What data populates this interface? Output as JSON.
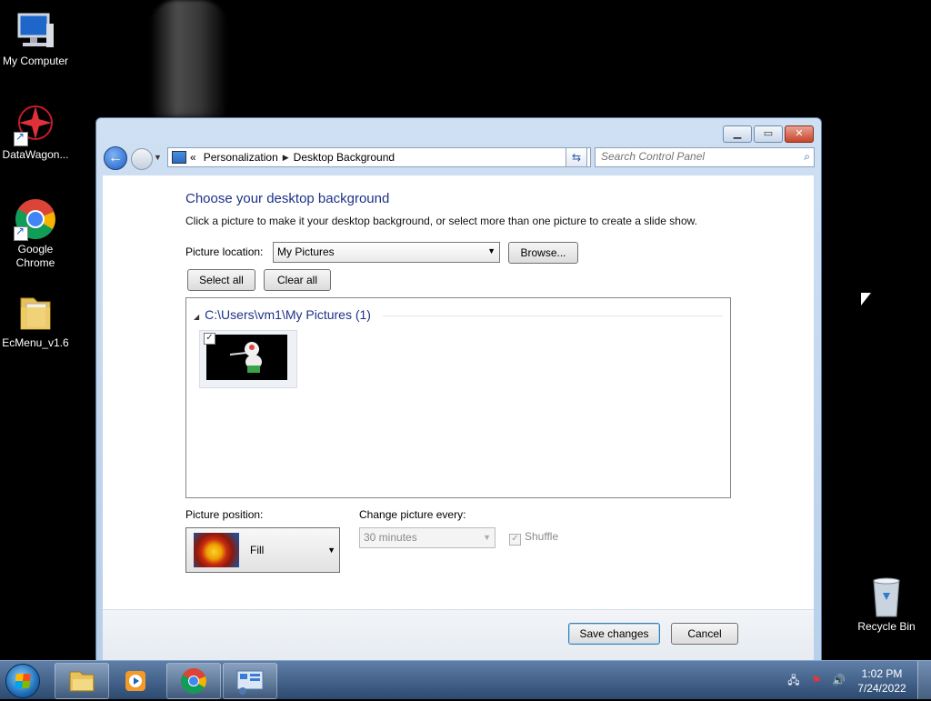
{
  "desktop": {
    "icons": [
      {
        "label": "My Computer"
      },
      {
        "label": "DataWagon..."
      },
      {
        "label": "Google Chrome"
      },
      {
        "label": "EcMenu_v1.6"
      },
      {
        "label": "Recycle Bin"
      }
    ]
  },
  "window": {
    "address": {
      "back_symbol": "«",
      "crumbs": [
        "Personalization",
        "Desktop Background"
      ]
    },
    "search": {
      "placeholder": "Search Control Panel"
    },
    "heading": "Choose your desktop background",
    "description": "Click a picture to make it your desktop background, or select more than one picture to create a slide show.",
    "picture_location": {
      "label": "Picture location:",
      "value": "My Pictures",
      "browse": "Browse..."
    },
    "select_all": "Select all",
    "clear_all": "Clear all",
    "gallery": {
      "group_title": "C:\\Users\\vm1\\My Pictures (1)",
      "items": [
        {
          "checked": true
        }
      ]
    },
    "picture_position": {
      "label": "Picture position:",
      "value": "Fill"
    },
    "change_picture": {
      "label": "Change picture every:",
      "value": "30 minutes"
    },
    "shuffle": {
      "label": "Shuffle",
      "checked": true
    },
    "save": "Save changes",
    "cancel": "Cancel"
  },
  "taskbar": {
    "clock": {
      "time": "1:02 PM",
      "date": "7/24/2022"
    }
  },
  "colors": {
    "heading": "#1e3287",
    "taskbar": "#2d4a70"
  }
}
